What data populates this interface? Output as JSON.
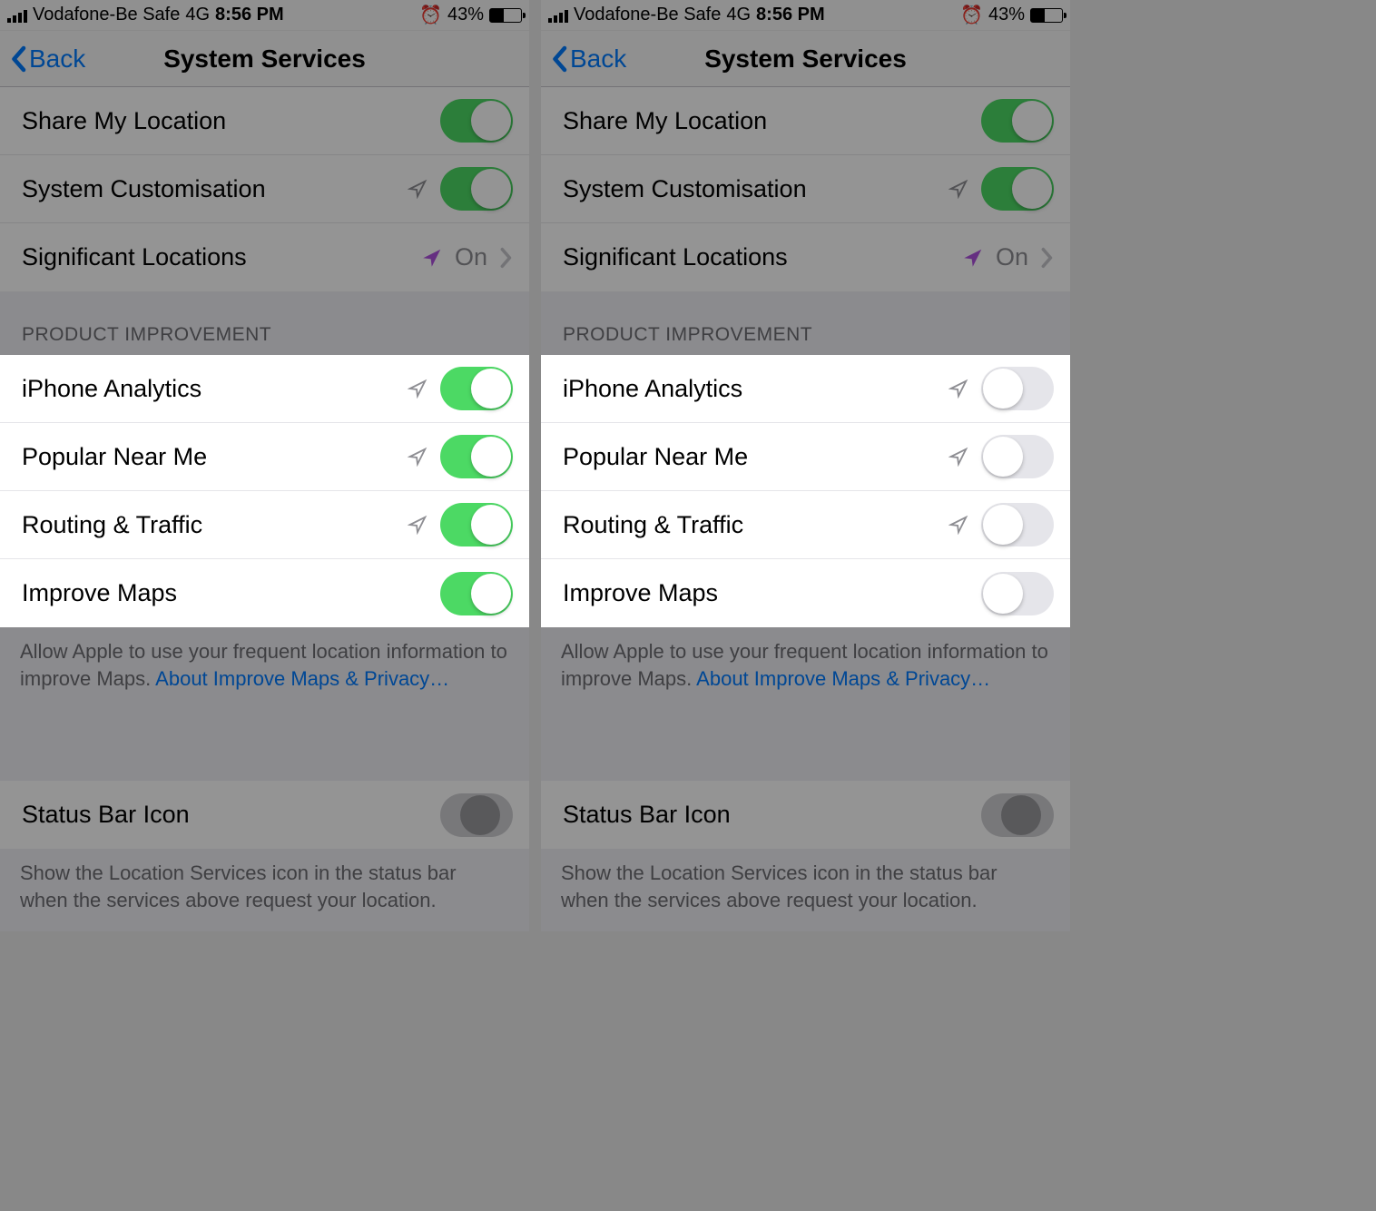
{
  "status": {
    "carrier": "Vodafone-Be Safe",
    "network": "4G",
    "time": "8:56 PM",
    "battery_pct": "43%"
  },
  "nav": {
    "back": "Back",
    "title": "System Services"
  },
  "rows": {
    "share_my_location": "Share My Location",
    "system_customisation": "System Customisation",
    "significant_locations": "Significant Locations",
    "significant_locations_value": "On",
    "iphone_analytics": "iPhone Analytics",
    "popular_near_me": "Popular Near Me",
    "routing_traffic": "Routing & Traffic",
    "improve_maps": "Improve Maps",
    "status_bar_icon": "Status Bar Icon"
  },
  "headers": {
    "product_improvement": "PRODUCT IMPROVEMENT"
  },
  "footers": {
    "improve_maps_text": "Allow Apple to use your frequent location information to improve Maps. ",
    "improve_maps_link": "About Improve Maps & Privacy…",
    "status_bar_text": "Show the Location Services icon in the status bar when the services above request your location."
  },
  "screens": [
    {
      "product_improvement_toggles": {
        "iphone_analytics": true,
        "popular_near_me": true,
        "routing_traffic": true,
        "improve_maps": true
      }
    },
    {
      "product_improvement_toggles": {
        "iphone_analytics": false,
        "popular_near_me": false,
        "routing_traffic": false,
        "improve_maps": false
      }
    }
  ]
}
